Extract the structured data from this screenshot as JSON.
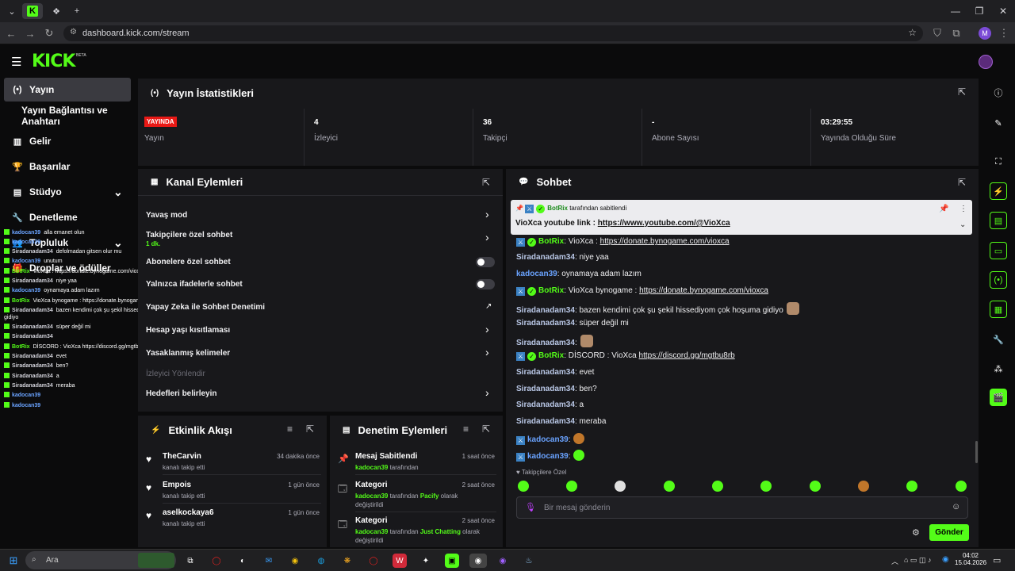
{
  "browser": {
    "url": "dashboard.kick.com/stream",
    "profile_initial": "M"
  },
  "header": {
    "logo": "KICK",
    "beta": "BETA"
  },
  "sidebar": {
    "items": [
      {
        "label": "Yayın",
        "icon": "broadcast-icon"
      },
      {
        "label": "Yayın Bağlantısı ve Anahtarı",
        "icon": ""
      },
      {
        "label": "Gelir",
        "icon": "chart-icon"
      },
      {
        "label": "Başarılar",
        "icon": "trophy-icon"
      },
      {
        "label": "Stüdyo",
        "icon": "studio-icon"
      },
      {
        "label": "Denetleme",
        "icon": "wrench-icon"
      },
      {
        "label": "Topluluk",
        "icon": "people-icon"
      },
      {
        "label": "Droplar ve ödüller",
        "icon": "gift-icon"
      }
    ]
  },
  "stats": {
    "title": "Yayın İstatistikleri",
    "live_badge": "YAYINDA",
    "cols": [
      {
        "value": "",
        "label": "Yayın"
      },
      {
        "value": "4",
        "label": "İzleyici"
      },
      {
        "value": "36",
        "label": "Takipçi"
      },
      {
        "value": "-",
        "label": "Abone Sayısı"
      },
      {
        "value": "03:29:55",
        "label": "Yayında Olduğu Süre"
      }
    ]
  },
  "channel_actions": {
    "title": "Kanal Eylemleri",
    "rows": [
      {
        "label": "Yavaş mod"
      },
      {
        "label": "Takipçilere özel sohbet",
        "sub": "1 dk."
      },
      {
        "label": "Abonelere özel sohbet"
      },
      {
        "label": "Yalnızca ifadelerle sohbet"
      },
      {
        "label": "Yapay Zeka ile Sohbet Denetimi"
      },
      {
        "label": "Hesap yaşı kısıtlaması"
      },
      {
        "label": "Yasaklanmış kelimeler"
      },
      {
        "label": "İzleyici Yönlendir"
      },
      {
        "label": "Hedefleri belirleyin"
      }
    ]
  },
  "activity": {
    "title": "Etkinlik Akışı",
    "items": [
      {
        "name": "TheCarvin",
        "sub": "kanalı takip etti",
        "time": "34 dakika önce"
      },
      {
        "name": "Empois",
        "sub": "kanalı takip etti",
        "time": "1 gün önce"
      },
      {
        "name": "aselkockaya6",
        "sub": "kanalı takip etti",
        "time": "1 gün önce"
      }
    ]
  },
  "moderation": {
    "title": "Denetim Eylemleri",
    "items": [
      {
        "title": "Mesaj Sabitlendi",
        "user": "kadocan39",
        "rest": " tarafından",
        "time": "1 saat önce"
      },
      {
        "title": "Kategori",
        "user": "kadocan39",
        "rest": " tarafından ",
        "target": "Pacify",
        "rest2": " olarak",
        "line2": "değiştirildi",
        "time": "2 saat önce"
      },
      {
        "title": "Kategori",
        "user": "kadocan39",
        "rest": " tarafından ",
        "target": "Just Chatting",
        "rest2": " olarak",
        "line2": "değiştirildi",
        "time": "2 saat önce"
      }
    ]
  },
  "chat": {
    "title": "Sohbet",
    "pinned_by": "BotRix",
    "pinned_suffix": " tarafından sabitlendi",
    "pinned_text": "VioXca youtube link : ",
    "pinned_link": "https://www.youtube.com/@VioXca",
    "messages": [
      {
        "user": "BotRix",
        "bot": true,
        "text": ": VioXca : ",
        "link": "https://donate.bynogame.com/vioxca"
      },
      {
        "user": "Siradanadam34",
        "text": ": niye yaa"
      },
      {
        "user": "kadocan39",
        "text": ": oynamaya adam lazım"
      },
      {
        "user": "BotRix",
        "bot": true,
        "text": ": VioXca bynogame : ",
        "link": "https://donate.bynogame.com/vioxca"
      },
      {
        "user": "Siradanadam34",
        "text": ": bazen kendimi çok şu şekil hissediyom çok hoşuma gidiyo",
        "emote": "cat"
      },
      {
        "user": "Siradanadam34",
        "text": ": süper değil mi"
      },
      {
        "user": "Siradanadam34",
        "text": ":",
        "emote": "cat"
      },
      {
        "user": "BotRix",
        "bot": true,
        "text": ": DİSCORD : VioXca ",
        "link": "https://discord.gg/mgtbu8rb"
      },
      {
        "user": "Siradanadam34",
        "text": ": evet"
      },
      {
        "user": "Siradanadam34",
        "text": ": ben?"
      },
      {
        "user": "Siradanadam34",
        "text": ": a"
      },
      {
        "user": "Siradanadam34",
        "text": ": meraba"
      },
      {
        "user": "kadocan39",
        "text": ":",
        "emote": "burger",
        "mod": true
      },
      {
        "user": "kadocan39",
        "text": ":",
        "emote": "green",
        "mod": true
      }
    ],
    "followers_only": "Takipçilere Özel",
    "input_placeholder": "Bir mesaj gönderin",
    "send": "Gönder"
  },
  "overlay": [
    {
      "user": "kadocan39",
      "text": "alla emanet olun"
    },
    {
      "user": "kadocan39",
      "text": ""
    },
    {
      "user": "Siradanadam34",
      "text": "defolmadan gitsen olur mu"
    },
    {
      "user": "kadocan39",
      "text": "unutum"
    },
    {
      "user": "BotRix",
      "text": "VioXca : https://donate.bynogame.com/vioxca"
    },
    {
      "user": "Siradanadam34",
      "text": "niye yaa"
    },
    {
      "user": "kadocan39",
      "text": "oynamaya adam lazım"
    },
    {
      "user": "BotRix",
      "text": "VioXca bynogame : https://donate.bynogame.com/vioxca"
    },
    {
      "user": "Siradanadam34",
      "text": "bazen kendimi çok şu şekil hissediyom çok hoşuma"
    },
    {
      "user": "",
      "text": "gidiyo"
    },
    {
      "user": "Siradanadam34",
      "text": "süper değil mi"
    },
    {
      "user": "Siradanadam34",
      "text": ""
    },
    {
      "user": "BotRix",
      "text": "DİSCORD : VioXca https://discord.gg/mgtbu8rb"
    },
    {
      "user": "Siradanadam34",
      "text": "evet"
    },
    {
      "user": "Siradanadam34",
      "text": "ben?"
    },
    {
      "user": "Siradanadam34",
      "text": "a"
    },
    {
      "user": "Siradanadam34",
      "text": "meraba"
    },
    {
      "user": "kadocan39",
      "text": ""
    },
    {
      "user": "kadocan39",
      "text": ""
    }
  ],
  "taskbar": {
    "search": "Ara",
    "time": "04:02",
    "date": "15.04.2026"
  },
  "colors": {
    "accent": "#53fc18",
    "panel": "#18181b",
    "live": "#e91916"
  }
}
